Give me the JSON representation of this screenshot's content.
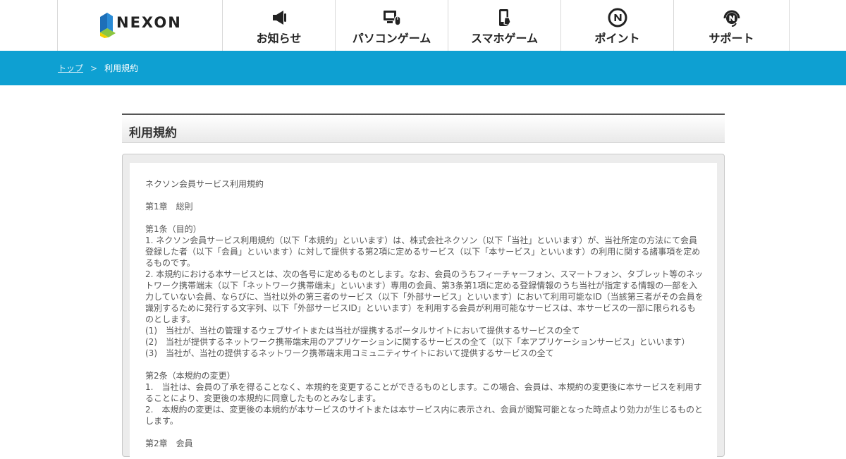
{
  "header": {
    "logo_text": "NEXON",
    "nav": [
      {
        "label": "お知らせ",
        "icon": "megaphone-icon"
      },
      {
        "label": "パソコンゲーム",
        "icon": "pc-mouse-icon"
      },
      {
        "label": "スマホゲーム",
        "icon": "smartphone-icon"
      },
      {
        "label": "ポイント",
        "icon": "n-coin-icon"
      },
      {
        "label": "サポート",
        "icon": "headset-icon"
      }
    ]
  },
  "breadcrumb": {
    "home": "トップ",
    "separator": ">",
    "current": "利用規約"
  },
  "page": {
    "title": "利用規約"
  },
  "terms": {
    "lines": [
      "ネクソン会員サービス利用規約",
      "",
      "第1章　総則",
      "",
      "第1条（目的）",
      "1. ネクソン会員サービス利用規約（以下「本規約」といいます）は、株式会社ネクソン（以下「当社」といいます）が、当社所定の方法にて会員登録した者（以下「会員」といいます）に対して提供する第2項に定めるサービス（以下「本サービス」といいます）の利用に関する諸事項を定めるものです。",
      "2. 本規約における本サービスとは、次の各号に定めるものとします。なお、会員のうちフィーチャーフォン、スマートフォン、タブレット等のネットワーク携帯端末（以下「ネットワーク携帯端末」といいます）専用の会員、第3条第1項に定める登録情報のうち当社が指定する情報の一部を入力していない会員、ならびに、当社以外の第三者のサービス（以下「外部サービス」といいます）において利用可能なID（当該第三者がその会員を識別するために発行する文字列、以下「外部サービスID」といいます）を利用する会員が利用可能なサービスは、本サービスの一部に限られるものとします。",
      "(1)　当社が、当社の管理するウェブサイトまたは当社が提携するポータルサイトにおいて提供するサービスの全て",
      "(2)　当社が提供するネットワーク携帯端末用のアプリケーションに関するサービスの全て（以下「本アプリケーションサービス」といいます）",
      "(3)　当社が、当社の提供するネットワーク携帯端末用コミュニティサイトにおいて提供するサービスの全て",
      "",
      "第2条（本規約の変更）",
      "1.　当社は、会員の了承を得ることなく、本規約を変更することができるものとします。この場合、会員は、本規約の変更後に本サービスを利用することにより、変更後の本規約に同意したものとみなします。",
      "2.　本規約の変更は、変更後の本規約が本サービスのサイトまたは本サービス内に表示され、会員が閲覧可能となった時点より効力が生じるものとします。",
      "",
      "第2章　会員"
    ]
  },
  "colors": {
    "breadcrumb_bg": "#0ea0d2",
    "logo_blue": "#1d6fb8",
    "logo_green": "#8cc63f",
    "logo_yellow": "#f3d000"
  }
}
